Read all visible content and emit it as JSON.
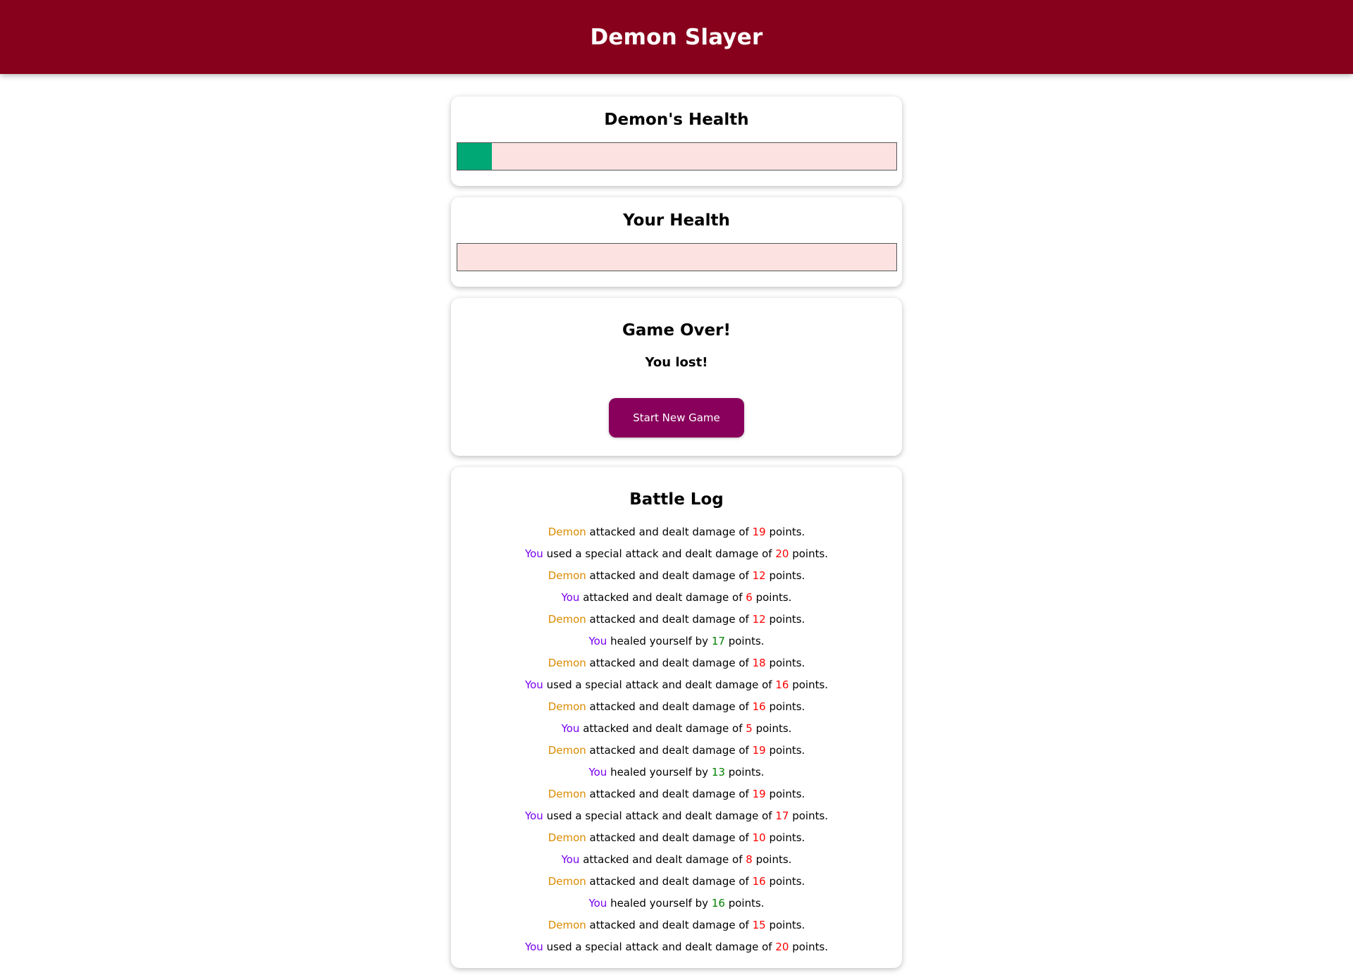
{
  "app": {
    "title": "Demon Slayer"
  },
  "colors": {
    "header": "#88011c",
    "health_fill": "#00a876",
    "bar_background": "#fde2e2",
    "button": "#88005b",
    "demon_text": "#da8a00",
    "player_text": "#7700f0",
    "damage_value": "#ff0000",
    "heal_value": "#008000"
  },
  "demon": {
    "heading": "Demon's Health",
    "health_percent": 8
  },
  "player": {
    "heading": "Your Health",
    "health_percent": 0
  },
  "game_over": {
    "heading": "Game Over!",
    "result": "You lost!",
    "button_label": "Start New Game"
  },
  "battle_log": {
    "heading": "Battle Log",
    "entries": [
      {
        "who": "Demon",
        "text": " attacked and dealt damage of ",
        "value": "19",
        "kind": "damage",
        "suffix": " points."
      },
      {
        "who": "You",
        "text": " used a special attack and dealt damage of ",
        "value": "20",
        "kind": "damage",
        "suffix": " points."
      },
      {
        "who": "Demon",
        "text": " attacked and dealt damage of ",
        "value": "12",
        "kind": "damage",
        "suffix": " points."
      },
      {
        "who": "You",
        "text": " attacked and dealt damage of ",
        "value": "6",
        "kind": "damage",
        "suffix": " points."
      },
      {
        "who": "Demon",
        "text": " attacked and dealt damage of ",
        "value": "12",
        "kind": "damage",
        "suffix": " points."
      },
      {
        "who": "You",
        "text": " healed yourself by ",
        "value": "17",
        "kind": "heal",
        "suffix": " points."
      },
      {
        "who": "Demon",
        "text": " attacked and dealt damage of ",
        "value": "18",
        "kind": "damage",
        "suffix": " points."
      },
      {
        "who": "You",
        "text": " used a special attack and dealt damage of ",
        "value": "16",
        "kind": "damage",
        "suffix": " points."
      },
      {
        "who": "Demon",
        "text": " attacked and dealt damage of ",
        "value": "16",
        "kind": "damage",
        "suffix": " points."
      },
      {
        "who": "You",
        "text": " attacked and dealt damage of ",
        "value": "5",
        "kind": "damage",
        "suffix": " points."
      },
      {
        "who": "Demon",
        "text": " attacked and dealt damage of ",
        "value": "19",
        "kind": "damage",
        "suffix": " points."
      },
      {
        "who": "You",
        "text": " healed yourself by ",
        "value": "13",
        "kind": "heal",
        "suffix": " points."
      },
      {
        "who": "Demon",
        "text": " attacked and dealt damage of ",
        "value": "19",
        "kind": "damage",
        "suffix": " points."
      },
      {
        "who": "You",
        "text": " used a special attack and dealt damage of ",
        "value": "17",
        "kind": "damage",
        "suffix": " points."
      },
      {
        "who": "Demon",
        "text": " attacked and dealt damage of ",
        "value": "10",
        "kind": "damage",
        "suffix": " points."
      },
      {
        "who": "You",
        "text": " attacked and dealt damage of ",
        "value": "8",
        "kind": "damage",
        "suffix": " points."
      },
      {
        "who": "Demon",
        "text": " attacked and dealt damage of ",
        "value": "16",
        "kind": "damage",
        "suffix": " points."
      },
      {
        "who": "You",
        "text": " healed yourself by ",
        "value": "16",
        "kind": "heal",
        "suffix": " points."
      },
      {
        "who": "Demon",
        "text": " attacked and dealt damage of ",
        "value": "15",
        "kind": "damage",
        "suffix": " points."
      },
      {
        "who": "You",
        "text": " used a special attack and dealt damage of ",
        "value": "20",
        "kind": "damage",
        "suffix": " points."
      }
    ]
  }
}
